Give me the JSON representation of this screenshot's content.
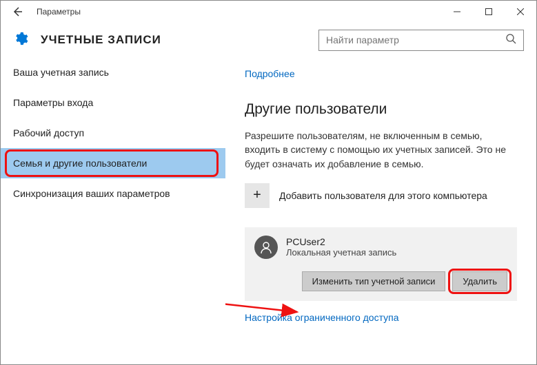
{
  "window": {
    "title": "Параметры"
  },
  "header": {
    "title": "УЧЕТНЫЕ ЗАПИСИ",
    "search_placeholder": "Найти параметр"
  },
  "sidebar": {
    "items": [
      {
        "label": "Ваша учетная запись"
      },
      {
        "label": "Параметры входа"
      },
      {
        "label": "Рабочий доступ"
      },
      {
        "label": "Семья и другие пользователи"
      },
      {
        "label": "Синхронизация ваших параметров"
      }
    ],
    "selected_index": 3
  },
  "main": {
    "details_link": "Подробнее",
    "section_title": "Другие пользователи",
    "description": "Разрешите пользователям, не включенным в семью, входить в систему с помощью их учетных записей. Это не будет означать их добавление в семью.",
    "add_user_label": "Добавить пользователя для этого компьютера",
    "user": {
      "name": "PCUser2",
      "type": "Локальная учетная запись",
      "change_type_btn": "Изменить тип учетной записи",
      "delete_btn": "Удалить"
    },
    "restricted_link": "Настройка ограниченного доступа"
  }
}
